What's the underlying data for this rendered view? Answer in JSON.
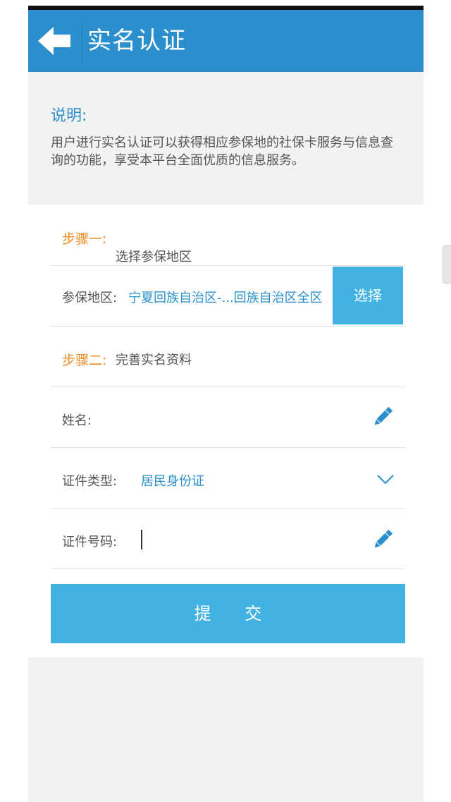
{
  "app_bar": {
    "title": "实名认证",
    "back_icon": "arrow-left-icon"
  },
  "description": {
    "title": "说明:",
    "text": "用户进行实名认证可以获得相应参保地的社保卡服务与信息查询的功能，享受本平台全面优质的信息服务。"
  },
  "step1": {
    "label": "步骤一:",
    "instruction": "选择参保地区",
    "region_label": "参保地区:",
    "region_value": "宁夏回族自治区-...回族自治区全区",
    "select_button": "选择"
  },
  "step2": {
    "label": "步骤二:",
    "instruction": "完善实名资料"
  },
  "form": {
    "name_label": "姓名:",
    "name_value": "",
    "id_type_label": "证件类型:",
    "id_type_value": "居民身份证",
    "id_number_label": "证件号码:",
    "id_number_value": ""
  },
  "submit_button": "提 交",
  "colors": {
    "primary": "#2a8fcc",
    "button": "#42b2e3",
    "step_orange": "#f08c24"
  }
}
